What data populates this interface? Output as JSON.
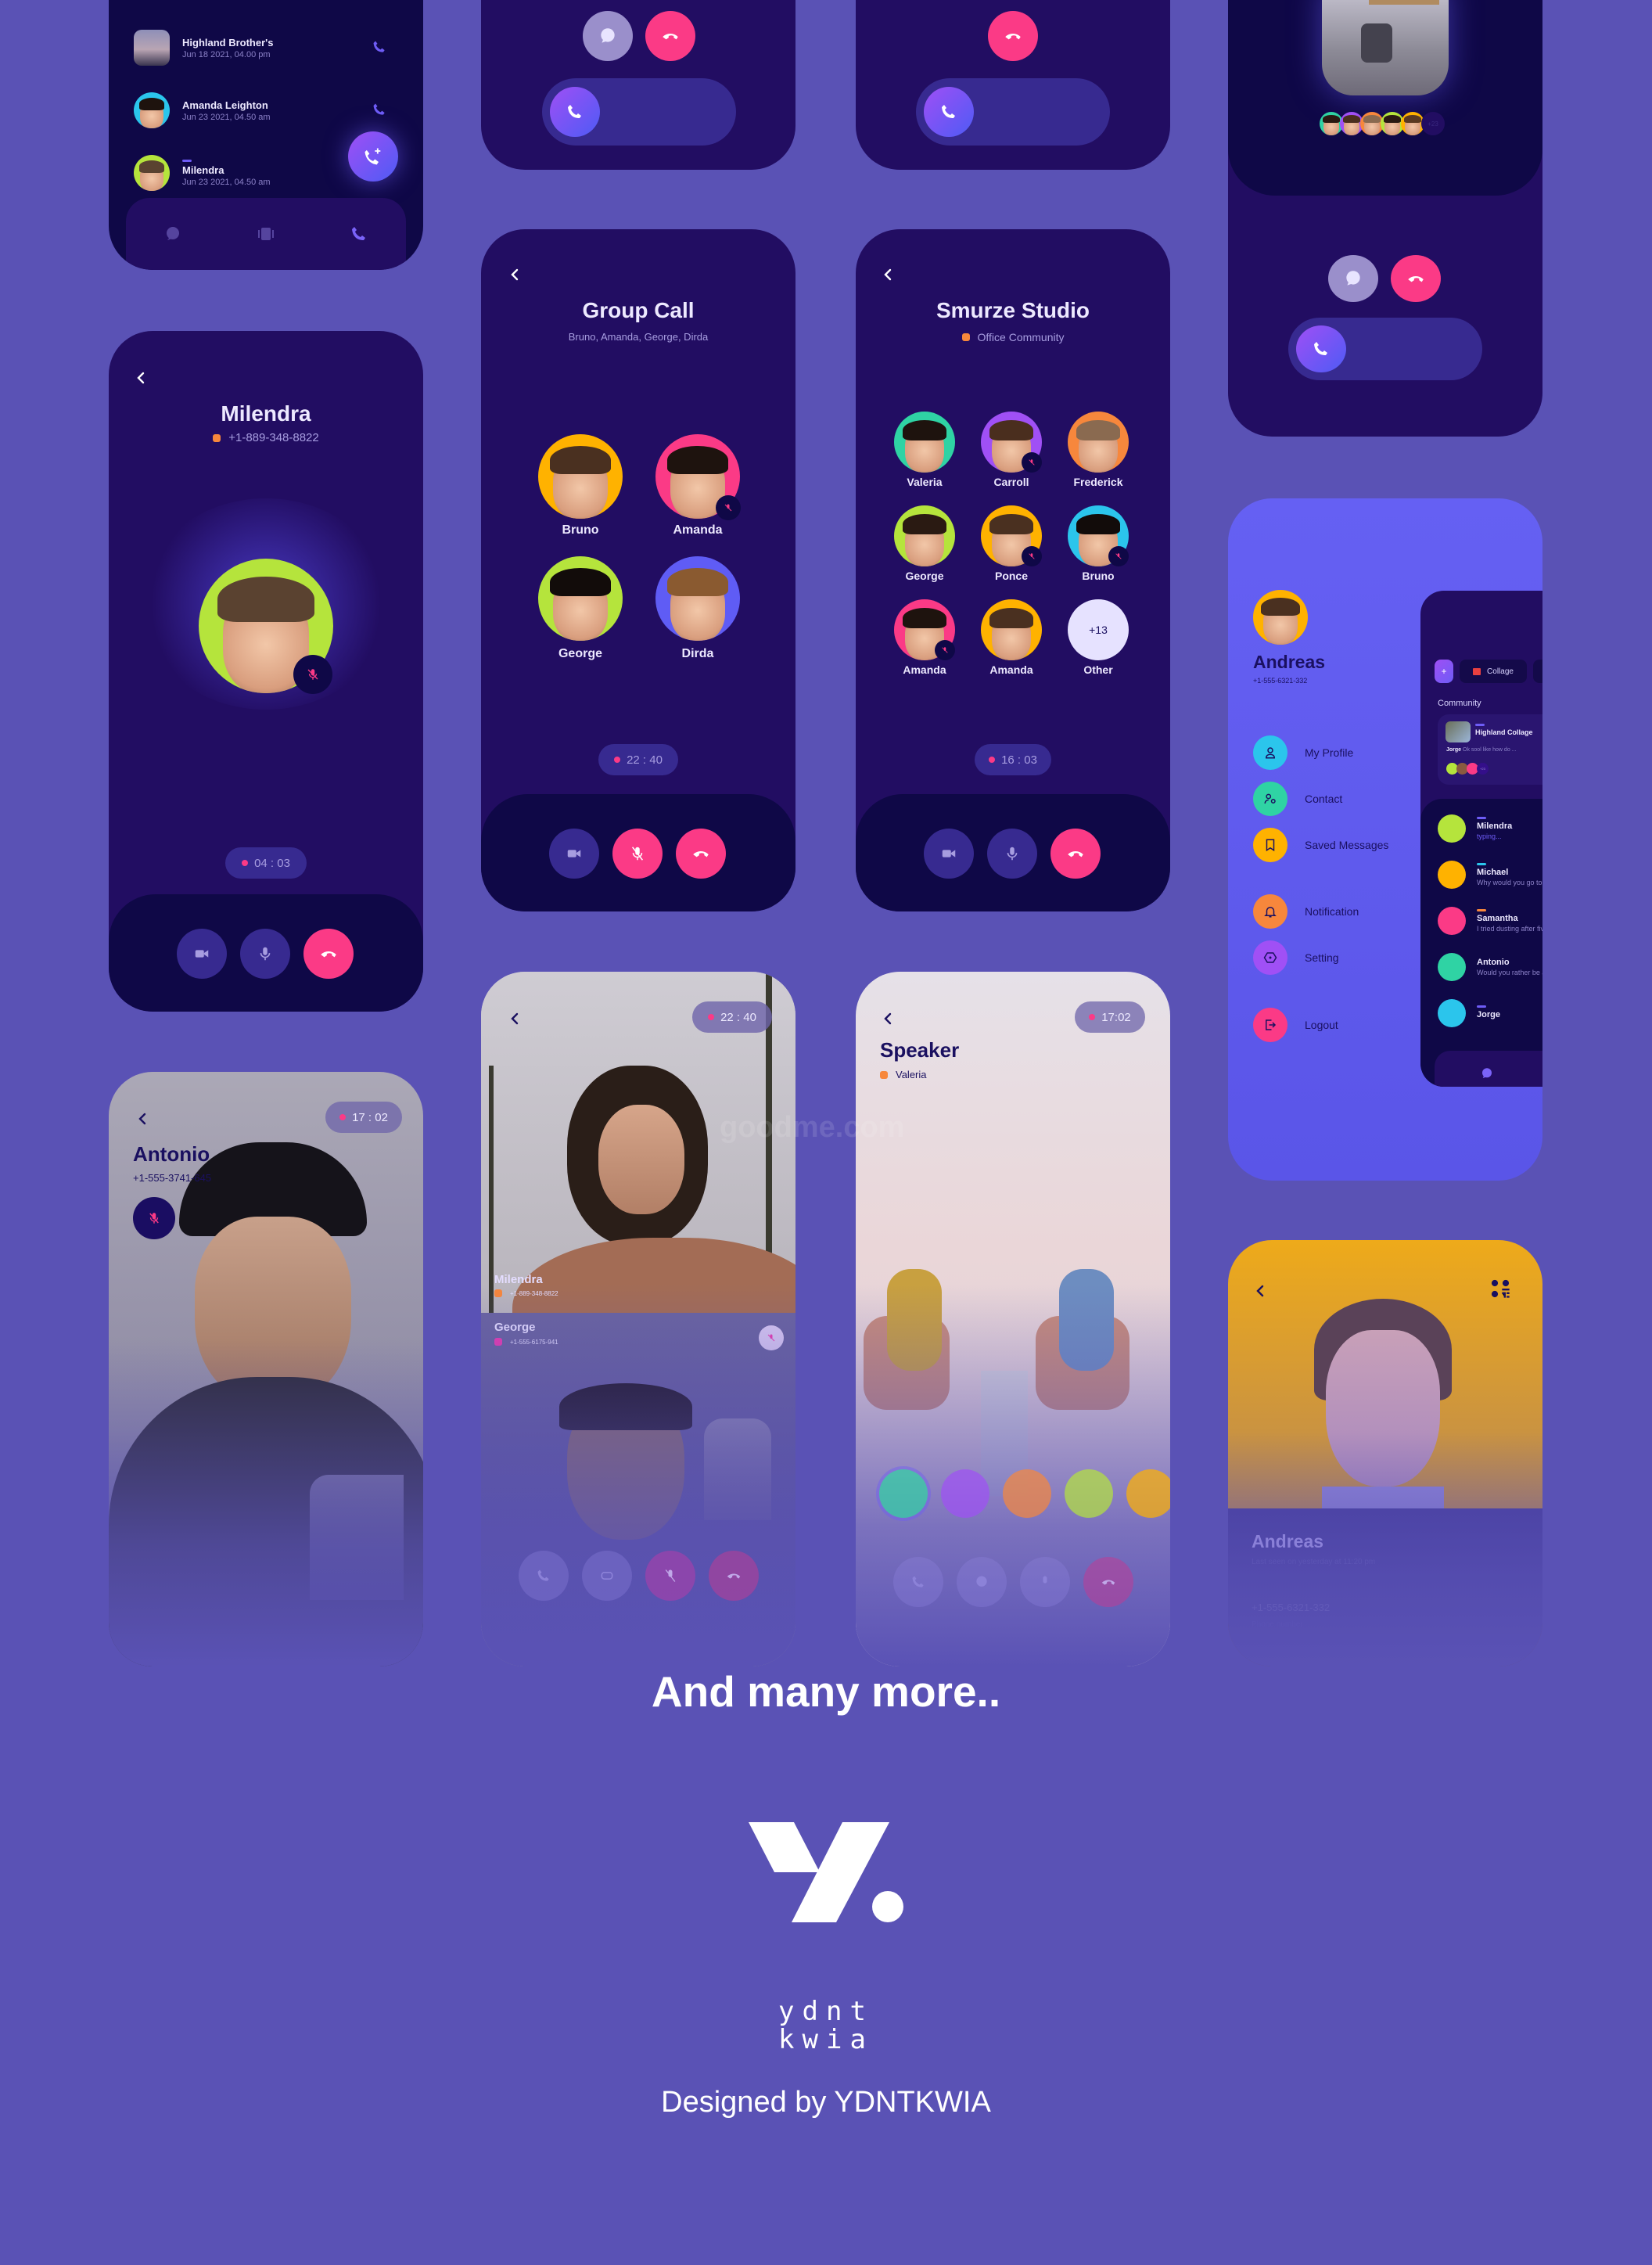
{
  "colors": {
    "page_bg": "#5A52B5",
    "phone_bg": "#220D62",
    "control_bar": "#0F0847",
    "button_dark": "#372A90",
    "accent_pink": "#FB3A86",
    "accent_orange": "#F7873C",
    "accent_purple": "#6E5CF6"
  },
  "call_log": {
    "items": [
      {
        "name": "Highland Brother's",
        "time": "Jun 18 2021, 04.00 pm",
        "avatar_color": "#7D7AA8"
      },
      {
        "name": "Amanda Leighton",
        "time": "Jun 23 2021, 04.50 am",
        "avatar_color": "#2BC5EC"
      },
      {
        "name": "Milendra",
        "time": "Jun 23 2021, 04.50 am",
        "avatar_color": "#B5E43C"
      }
    ],
    "fab_icon": "add-call-icon",
    "nav": [
      "chat-icon",
      "stories-icon",
      "phone-icon"
    ]
  },
  "incoming_a": {
    "buttons": [
      "message-icon",
      "decline-icon"
    ],
    "slider_icon": "phone-icon"
  },
  "incoming_b": {
    "buttons": [
      "decline-icon"
    ],
    "slider_icon": "phone-icon"
  },
  "room_call": {
    "participants_colors": [
      "#2FD3A4",
      "#A050F5",
      "#F7873C",
      "#B5E43C",
      "#FFB200"
    ],
    "more_count": "+23",
    "buttons": [
      "message-icon",
      "decline-icon"
    ],
    "slider_icon": "phone-icon"
  },
  "single_call": {
    "name": "Milendra",
    "phone": "+1-889-348-8822",
    "status_color": "#F7873C",
    "avatar_color": "#B5E43C",
    "timer": "04 : 03",
    "controls": [
      "video-icon",
      "mic-icon",
      "end-call-icon"
    ]
  },
  "group_call": {
    "title": "Group Call",
    "subtitle": "Bruno, Amanda,  George, Dirda",
    "participants": [
      {
        "name": "Bruno",
        "color": "#FFB200",
        "muted": false
      },
      {
        "name": "Amanda",
        "color": "#FB3A86",
        "muted": true
      },
      {
        "name": "George",
        "color": "#B5E43C",
        "muted": false
      },
      {
        "name": "Dirda",
        "color": "#5F5CF5",
        "muted": false
      }
    ],
    "timer": "22 : 40",
    "controls": [
      "video-icon",
      "mic-off-icon",
      "end-call-icon"
    ]
  },
  "studio_call": {
    "title": "Smurze Studio",
    "subtitle": "Office Community",
    "status_color": "#F7873C",
    "participants": [
      {
        "name": "Valeria",
        "color": "#2FD3A4",
        "muted": false
      },
      {
        "name": "Carroll",
        "color": "#A050F5",
        "muted": true
      },
      {
        "name": "Frederick",
        "color": "#F7873C",
        "muted": false
      },
      {
        "name": "George",
        "color": "#B5E43C",
        "muted": false
      },
      {
        "name": "Ponce",
        "color": "#FFB200",
        "muted": true
      },
      {
        "name": "Bruno",
        "color": "#2BC5EC",
        "muted": true
      },
      {
        "name": "Amanda",
        "color": "#FB3A86",
        "muted": true
      },
      {
        "name": "Amanda",
        "color": "#FFB200",
        "muted": false
      }
    ],
    "other": {
      "count": "+13",
      "label": "Other"
    },
    "timer": "16 : 03",
    "controls": [
      "video-icon",
      "mic-icon",
      "end-call-icon"
    ]
  },
  "profile_menu": {
    "name": "Andreas",
    "phone": "+1-555-6321-332",
    "items": [
      {
        "label": "My Profile",
        "icon": "user-icon",
        "color": "#2BC5EC"
      },
      {
        "label": "Contact",
        "icon": "contacts-icon",
        "color": "#2FD3A4"
      },
      {
        "label": "Saved Messages",
        "icon": "bookmark-icon",
        "color": "#FFB200"
      },
      {
        "label": "Notification",
        "icon": "bell-icon",
        "color": "#F7873C"
      },
      {
        "label": "Setting",
        "icon": "settings-icon",
        "color": "#A050F5"
      },
      {
        "label": "Logout",
        "icon": "logout-icon",
        "color": "#FB3A86"
      }
    ],
    "chat_preview": {
      "add_label": "+",
      "tab": "Collage",
      "section": "Community",
      "community": {
        "name": "Highland Collage",
        "sender": "Jorge",
        "message": "Ok sool like how do ...",
        "more": "+23"
      },
      "chats": [
        {
          "name": "Milendra",
          "message": "typing...",
          "color": "#B5E43C",
          "mark": "#6E5CF6"
        },
        {
          "name": "Michael",
          "message": "Why would you go to a",
          "color": "#FFB200",
          "mark": "#2BC5EC"
        },
        {
          "name": "Samantha",
          "message": "I tried dusting after five",
          "color": "#FB3A86",
          "mark": "#F7873C"
        },
        {
          "name": "Antonio",
          "message": "Would you rather be an",
          "color": "#2FD3A4",
          "mark": ""
        },
        {
          "name": "Jorge",
          "message": "",
          "color": "#2BC5EC",
          "mark": "#6E5CF6"
        }
      ]
    }
  },
  "video_call_antonio": {
    "name": "Antonio",
    "phone": "+1-555-3741-645",
    "timer": "17 : 02"
  },
  "video_call_group": {
    "timer": "22 : 40",
    "top": {
      "name": "Milendra",
      "phone": "+1-889-348-8822",
      "status_color": "#F7873C"
    },
    "bottom": {
      "name": "George",
      "phone": "+1-555-6175-941",
      "status_color": "#E83BB0"
    },
    "controls": [
      "phone-icon",
      "flip-camera-icon",
      "mic-off-icon",
      "end-call-icon"
    ]
  },
  "speaker_call": {
    "title": "Speaker",
    "speaker": "Valeria",
    "status_color": "#F7873C",
    "timer": "17:02",
    "listeners_colors": [
      "#2FD3A4",
      "#A050F5",
      "#F7873C",
      "#B5E43C",
      "#FFB200"
    ],
    "controls": [
      "phone-icon",
      "message-icon",
      "mic-icon",
      "end-call-icon"
    ]
  },
  "contact_detail": {
    "name": "Andreas",
    "last_seen": "Last seen on yesterday at 11:20 pm",
    "phone": "+1-555-6321-332",
    "phone_label": "Phone number"
  },
  "watermark": "goodme.com",
  "footer": {
    "headline": "And many more..",
    "logo_line1": "ydnt",
    "logo_line2": "kwia",
    "credit": "Designed by YDNTKWIA"
  }
}
